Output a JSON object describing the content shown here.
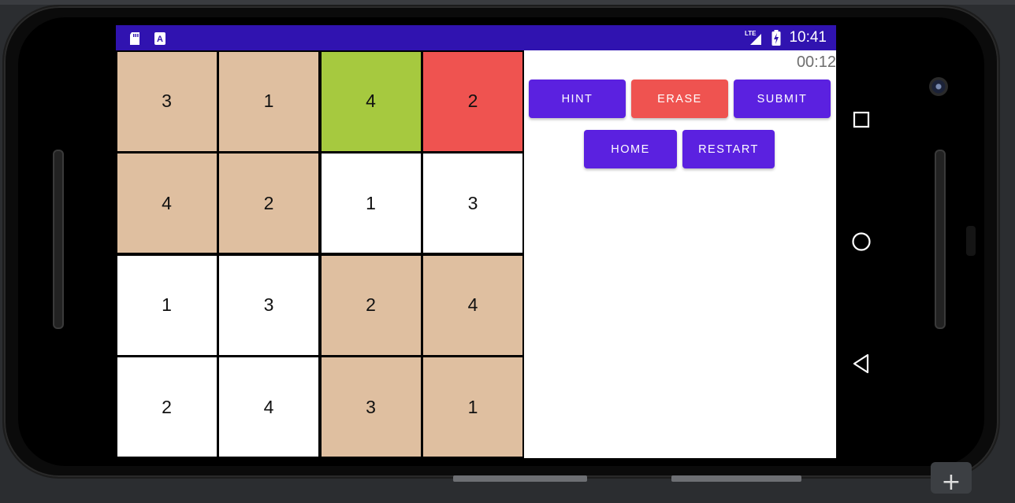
{
  "status_bar": {
    "time": "10:41",
    "network": "LTE",
    "icons": [
      "sd-card-icon",
      "app-notification-icon",
      "lte-signal-icon",
      "battery-charging-icon"
    ],
    "color": "#3013b0"
  },
  "timer": "00:12",
  "buttons": {
    "hint": "HINT",
    "erase": "ERASE",
    "submit": "SUBMIT",
    "home": "HOME",
    "restart": "RESTART"
  },
  "colors": {
    "primary_button": "#5b21e0",
    "erase_button": "#ef5350",
    "given_cell": "#dfbfa0",
    "correct_cell": "#a6c93f",
    "wrong_cell": "#ef5350",
    "empty_cell": "#ffffff"
  },
  "grid": {
    "rows": [
      [
        {
          "value": "3",
          "state": "given"
        },
        {
          "value": "1",
          "state": "given"
        },
        {
          "value": "4",
          "state": "correct"
        },
        {
          "value": "2",
          "state": "wrong"
        }
      ],
      [
        {
          "value": "4",
          "state": "given"
        },
        {
          "value": "2",
          "state": "given"
        },
        {
          "value": "1",
          "state": "user"
        },
        {
          "value": "3",
          "state": "user"
        }
      ],
      [
        {
          "value": "1",
          "state": "user"
        },
        {
          "value": "3",
          "state": "user"
        },
        {
          "value": "2",
          "state": "given"
        },
        {
          "value": "4",
          "state": "given"
        }
      ],
      [
        {
          "value": "2",
          "state": "user"
        },
        {
          "value": "4",
          "state": "user"
        },
        {
          "value": "3",
          "state": "given"
        },
        {
          "value": "1",
          "state": "given"
        }
      ]
    ]
  },
  "nav_bar": {
    "icons": [
      "overview-square-icon",
      "home-circle-icon",
      "back-triangle-icon"
    ]
  }
}
